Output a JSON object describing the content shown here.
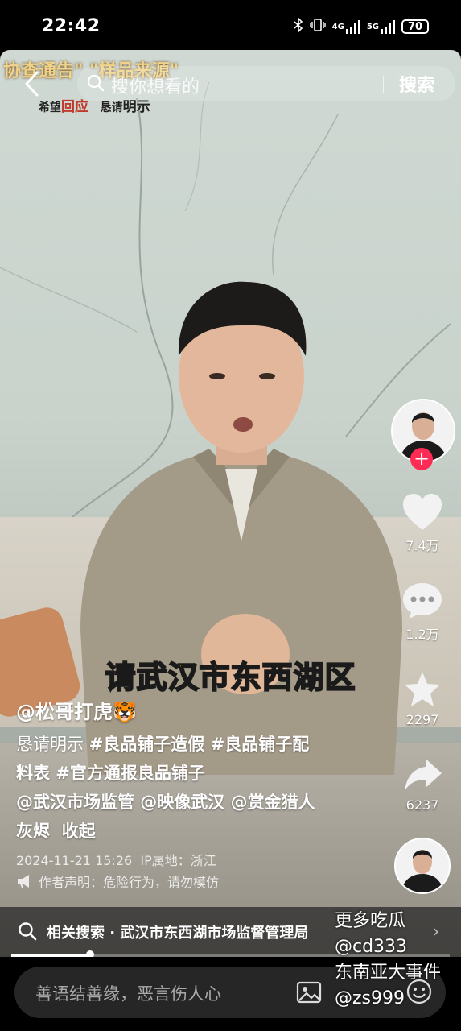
{
  "status_bar": {
    "time": "22:42",
    "network_1": "4G",
    "network_2": "5G",
    "battery": "70"
  },
  "search": {
    "placeholder": "搜你想看的",
    "button_label": "搜索"
  },
  "video_overlay": {
    "caption_top": "协查通告\"  \"样品来源\"",
    "caption_sub_1": "希望",
    "caption_sub_1_red": "回应",
    "caption_sub_2": "恳请",
    "caption_sub_2_bold": "明示",
    "subtitle": "请武汉市东西湖区"
  },
  "actions": {
    "likes": "7.4万",
    "comments": "1.2万",
    "favorites": "2297",
    "shares": "6237",
    "follow": "+"
  },
  "post": {
    "author": "@松哥打虎🐯",
    "desc_line1_plain": "恳请明示 ",
    "desc_line1_tag1": "#良品铺子造假",
    "desc_line1_tag2": " #良品铺子配",
    "desc_line2": "料表 #官方通报良品铺子",
    "desc_line3": "@武汉市场监管 @映像武汉 @赏金猎人",
    "desc_line4_a": "灰烬",
    "desc_line4_b": "收起",
    "datetime": "2024-11-21 15:26",
    "ip_location": "IP属地：浙江",
    "declaration": "作者声明：危险行为，请勿模仿"
  },
  "related": {
    "text": "相关搜索 · 武汉市东西湖市场监督管理局",
    "progress": 0.18
  },
  "watermark": {
    "line1": "更多吃瓜",
    "line2": "@cd333",
    "line3": "东南亚大事件",
    "line4": "@zs999"
  },
  "comment": {
    "placeholder": "善语结善缘，恶言伤人心"
  },
  "colors": {
    "subtitle": "#f5d63a",
    "follow": "#fe2c55"
  }
}
